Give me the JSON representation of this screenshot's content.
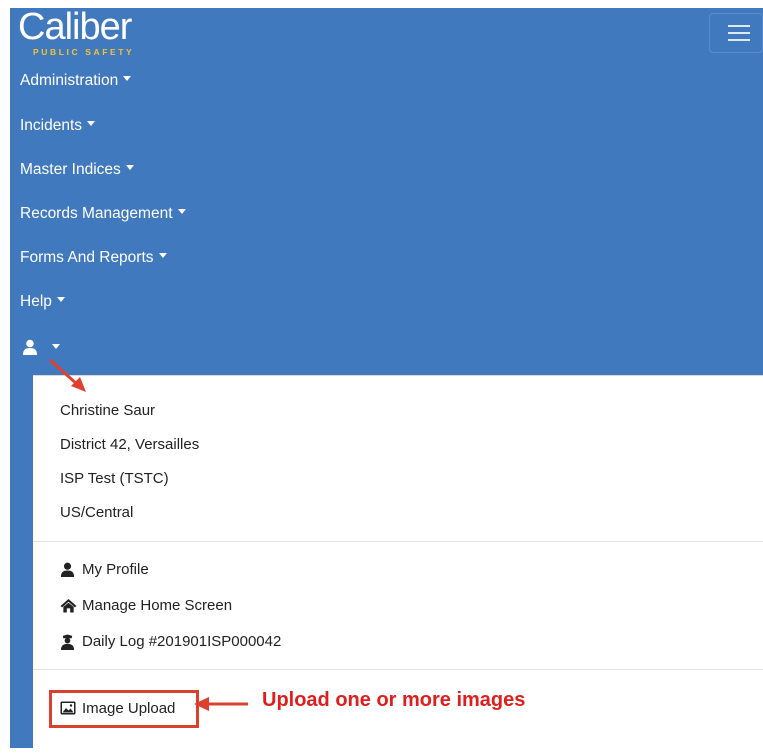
{
  "brand": {
    "name": "Caliber",
    "tagline": "PUBLIC SAFETY"
  },
  "nav": {
    "items": [
      {
        "label": "Administration"
      },
      {
        "label": "Incidents"
      },
      {
        "label": "Master Indices"
      },
      {
        "label": "Records Management"
      },
      {
        "label": "Forms And Reports"
      },
      {
        "label": "Help"
      }
    ],
    "menu_toggle_icon": "hamburger-icon",
    "user_icon": "user-icon"
  },
  "user_menu": {
    "info": {
      "name": "Christine Saur",
      "location": "District 42, Versailles",
      "agency": "ISP Test (TSTC)",
      "timezone": "US/Central"
    },
    "links": [
      {
        "label": "My Profile",
        "icon": "user-icon"
      },
      {
        "label": "Manage Home Screen",
        "icon": "home-icon"
      },
      {
        "label": "Daily Log #201901ISP000042",
        "icon": "officer-icon"
      }
    ],
    "image_upload": {
      "label": "Image Upload",
      "icon": "image-icon"
    }
  },
  "annotation": {
    "text": "Upload one or more images",
    "color": "#e01e1e"
  },
  "colors": {
    "navbar": "#4179be",
    "brand_accent": "#f4c430",
    "highlight": "#d9412c"
  }
}
